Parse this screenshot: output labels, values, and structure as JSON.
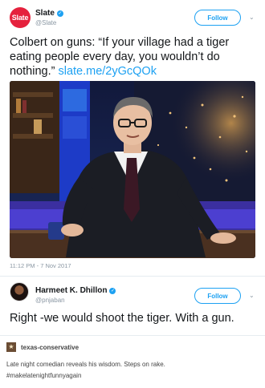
{
  "tweet1": {
    "avatar_text": "Slate",
    "name": "Slate",
    "handle": "@Slate",
    "follow_label": "Follow",
    "text": "Colbert on guns: “If your village had a tiger eating people every day, you wouldn’t do nothing.” ",
    "link": "slate.me/2yGcQOk",
    "timestamp": "11:12 PM - 7 Nov 2017"
  },
  "tweet2": {
    "name": "Harmeet K. Dhillon",
    "handle": "@pnjaban",
    "follow_label": "Follow",
    "text": "Right -we would shoot the tiger. With a gun."
  },
  "post": {
    "avatar_glyph": "★",
    "username": "texas-conservative",
    "body": "Late night comedian reveals his wisdom.  Steps on rake.",
    "tag": "#makelatenightfunnyagain"
  },
  "colors": {
    "brand_red": "#e5213d",
    "twitter_blue": "#1da1f2",
    "text": "#14171a",
    "muted": "#8a97a3"
  },
  "icons": {
    "verified": "verified-badge-icon",
    "chevron": "chevron-down-icon"
  }
}
